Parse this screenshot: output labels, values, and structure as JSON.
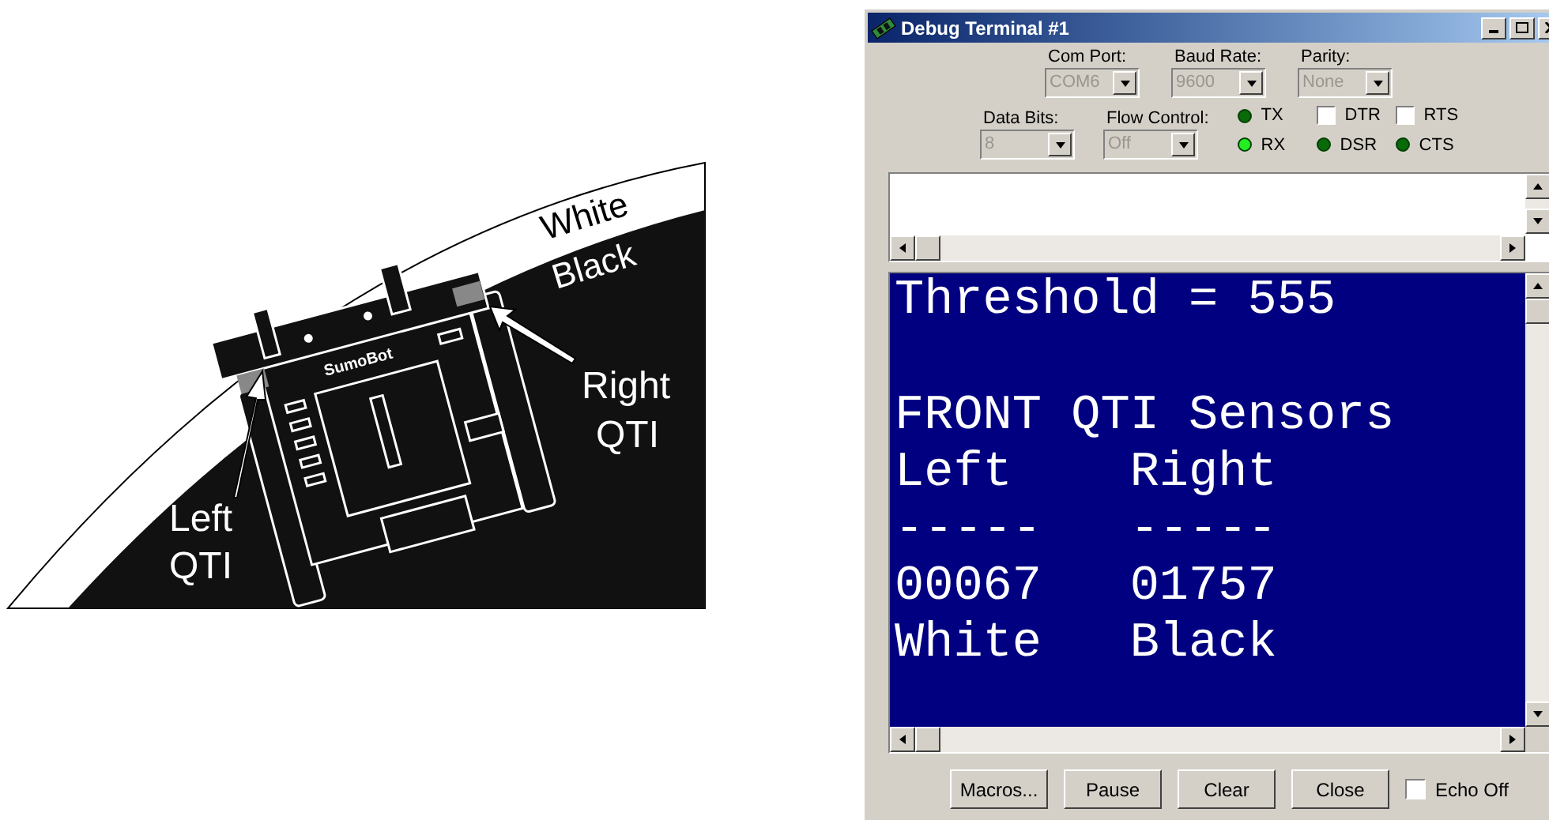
{
  "diagram": {
    "white_label": "White",
    "black_label": "Black",
    "robot_label": "SumoBot",
    "left_label": [
      "Left",
      "QTI"
    ],
    "right_label": [
      "Right",
      "QTI"
    ]
  },
  "window": {
    "title": "Debug Terminal #1"
  },
  "port_settings": [
    {
      "label": "Com Port:",
      "value": "COM6",
      "disabled": true
    },
    {
      "label": "Baud Rate:",
      "value": "9600",
      "disabled": true
    },
    {
      "label": "Parity:",
      "value": "None",
      "disabled": true
    }
  ],
  "line_settings": [
    {
      "label": "Data Bits:",
      "value": "8",
      "disabled": true
    },
    {
      "label": "Flow Control:",
      "value": "Off",
      "disabled": true
    }
  ],
  "signals": [
    {
      "kind": "led",
      "label": "TX",
      "on": false
    },
    {
      "kind": "checkbox",
      "label": "DTR",
      "checked": false
    },
    {
      "kind": "checkbox",
      "label": "RTS",
      "checked": false
    },
    {
      "kind": "led",
      "label": "RX",
      "on": true
    },
    {
      "kind": "led",
      "label": "DSR",
      "on": false
    },
    {
      "kind": "led",
      "label": "CTS",
      "on": false
    }
  ],
  "terminal": {
    "blocks": [
      [
        "Threshold = 555"
      ],
      [
        "FRONT QTI Sensors",
        "Left    Right",
        "-----   -----",
        "00067   01757",
        "White   Black"
      ]
    ]
  },
  "buttons": [
    "Macros...",
    "Pause",
    "Clear",
    "Close"
  ],
  "echo_off": {
    "label": "Echo Off",
    "checked": false
  }
}
